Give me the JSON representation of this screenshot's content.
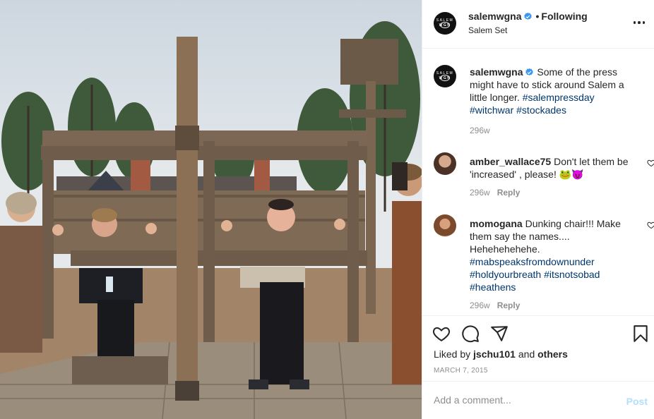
{
  "post": {
    "username": "salemwgna",
    "follow_status": "Following",
    "location": "Salem Set",
    "logo_text_top": "SALEM",
    "logo_text_bottom": "WGN"
  },
  "caption": {
    "username": "salemwgna",
    "text": "Some of the press might have to stick around Salem a little longer.",
    "hashtags": [
      "#salempressday",
      "#witchwar",
      "#stockades"
    ],
    "time": "296w"
  },
  "comments": [
    {
      "username": "amber_wallace75",
      "text": "Don't let them be 'increased' , please! 🐸😈",
      "time": "296w",
      "reply_label": "Reply"
    },
    {
      "username": "momogana",
      "text": "Dunking chair!!! Make them say the names.... Hehehehehehe.",
      "hashtags": [
        "#mabspeaksfromdownunder",
        "#holdyourbreath",
        "#itsnotsobad",
        "#heathens"
      ],
      "time": "296w",
      "reply_label": "Reply"
    }
  ],
  "likes": {
    "prefix": "Liked by",
    "user": "jschu101",
    "and": "and",
    "others": "others"
  },
  "date": "MARCH 7, 2015",
  "add_comment": {
    "placeholder": "Add a comment...",
    "post_label": "Post"
  },
  "icons": {
    "like": "heart-icon",
    "comment": "comment-icon",
    "share": "share-icon",
    "save": "bookmark-icon",
    "more": "more-options-icon",
    "verified": "verified-badge-icon"
  },
  "colors": {
    "link": "#00376b",
    "verified": "#3897f0",
    "muted": "#8e8e8e",
    "post_disabled": "#b2dffc"
  }
}
